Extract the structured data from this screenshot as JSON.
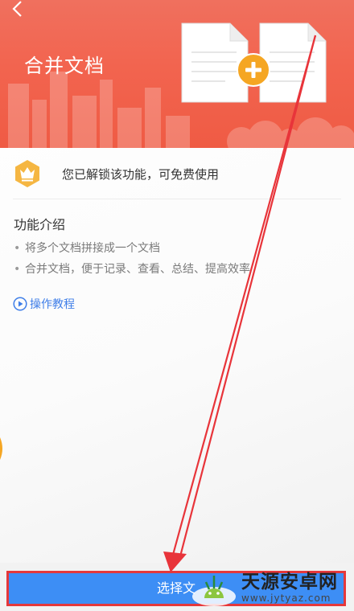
{
  "banner": {
    "title": "合并文档",
    "back_icon": "chevron-left-icon",
    "plus_icon": "plus-circle-icon",
    "colors": {
      "banner": "#f2644f",
      "plus": "#f5a623"
    }
  },
  "unlock": {
    "text": "您已解锁该功能，可免费使用",
    "icon": "crown-icon",
    "icon_color": "#f5b642"
  },
  "intro": {
    "title": "功能介绍",
    "items": [
      "将多个文档拼接成一个文档",
      "合并文档，便于记录、查看、总结、提高效率"
    ]
  },
  "tutorial": {
    "label": "操作教程",
    "icon": "play-circle-icon",
    "color": "#3f7ee8"
  },
  "bottom_button": {
    "label": "选择文",
    "color": "#3d8ef5",
    "highlight_color": "#e5383b"
  },
  "watermark": {
    "name": "天源安卓网",
    "url": "www.jytyaz.com"
  },
  "annotation": {
    "type": "arrow",
    "color": "#e8343a"
  }
}
